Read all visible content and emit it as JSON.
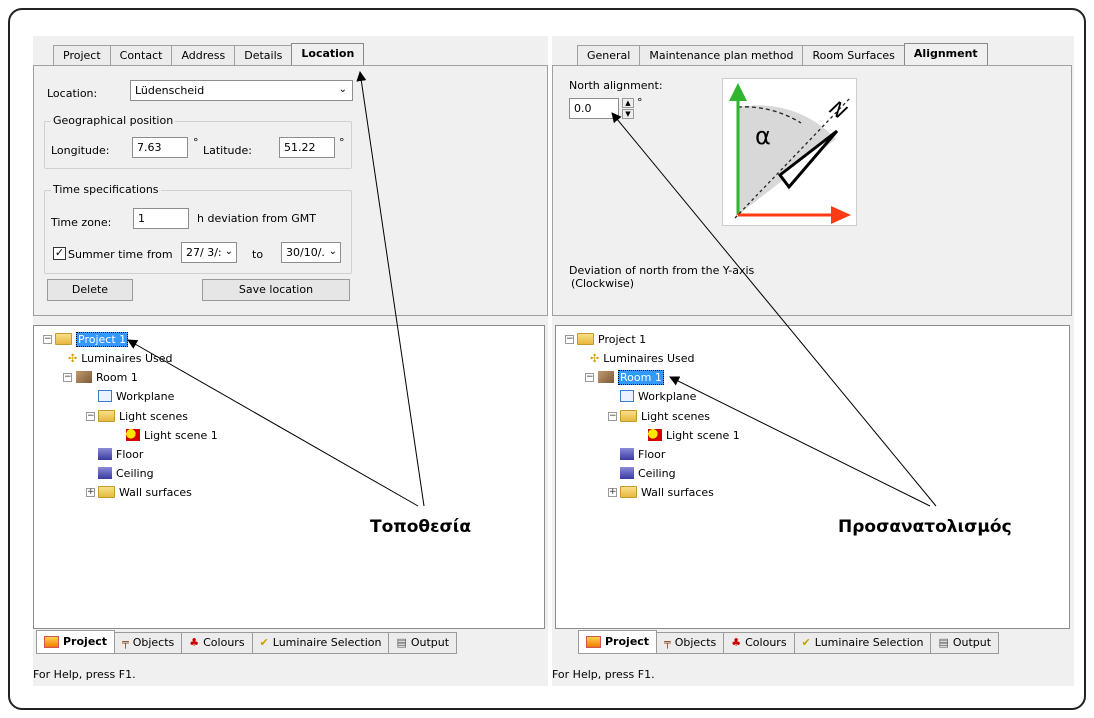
{
  "left": {
    "tabs": [
      "Project",
      "Contact",
      "Address",
      "Details",
      "Location"
    ],
    "location_label": "Location:",
    "location_value": "Lüdenscheid",
    "geo_title": "Geographical position",
    "longitude_label": "Longitude:",
    "longitude_value": "7.63",
    "deg1": "°",
    "latitude_label": "Latitude:",
    "latitude_value": "51.22",
    "deg2": "°",
    "time_title": "Time specifications",
    "timezone_label": "Time zone:",
    "timezone_value": "1",
    "timezone_suffix": "h deviation from GMT",
    "summer_label": "Summer time",
    "from_label": "from",
    "from_value": "27/ 3/:",
    "to_label": "to",
    "to_value": "30/10/.",
    "delete_label": "Delete",
    "save_label": "Save location",
    "tree": {
      "project": "Project 1",
      "luminaires": "Luminaires Used",
      "room": "Room 1",
      "workplane": "Workplane",
      "light_scenes": "Light scenes",
      "light_scene": "Light scene 1",
      "floor": "Floor",
      "ceiling": "Ceiling",
      "wall": "Wall surfaces"
    },
    "callout": "Τοποθεσία",
    "bottom_tabs": [
      "Project",
      "Objects",
      "Colours",
      "Luminaire Selection",
      "Output"
    ],
    "status": "For Help, press F1."
  },
  "right": {
    "tabs": [
      "General",
      "Maintenance plan method",
      "Room Surfaces",
      "Alignment"
    ],
    "north_label": "North alignment:",
    "north_value": "0.0",
    "deg": "°",
    "diagram_alpha": "α",
    "diagram_n": "N",
    "deviation_line1": "Deviation of north from the Y-axis",
    "deviation_line2": "(Clockwise)",
    "tree": {
      "project": "Project 1",
      "luminaires": "Luminaires Used",
      "room": "Room 1",
      "workplane": "Workplane",
      "light_scenes": "Light scenes",
      "light_scene": "Light scene 1",
      "floor": "Floor",
      "ceiling": "Ceiling",
      "wall": "Wall surfaces"
    },
    "callout": "Προσανατολισμός",
    "bottom_tabs": [
      "Project",
      "Objects",
      "Colours",
      "Luminaire Selection",
      "Output"
    ],
    "status": "For Help, press F1."
  }
}
